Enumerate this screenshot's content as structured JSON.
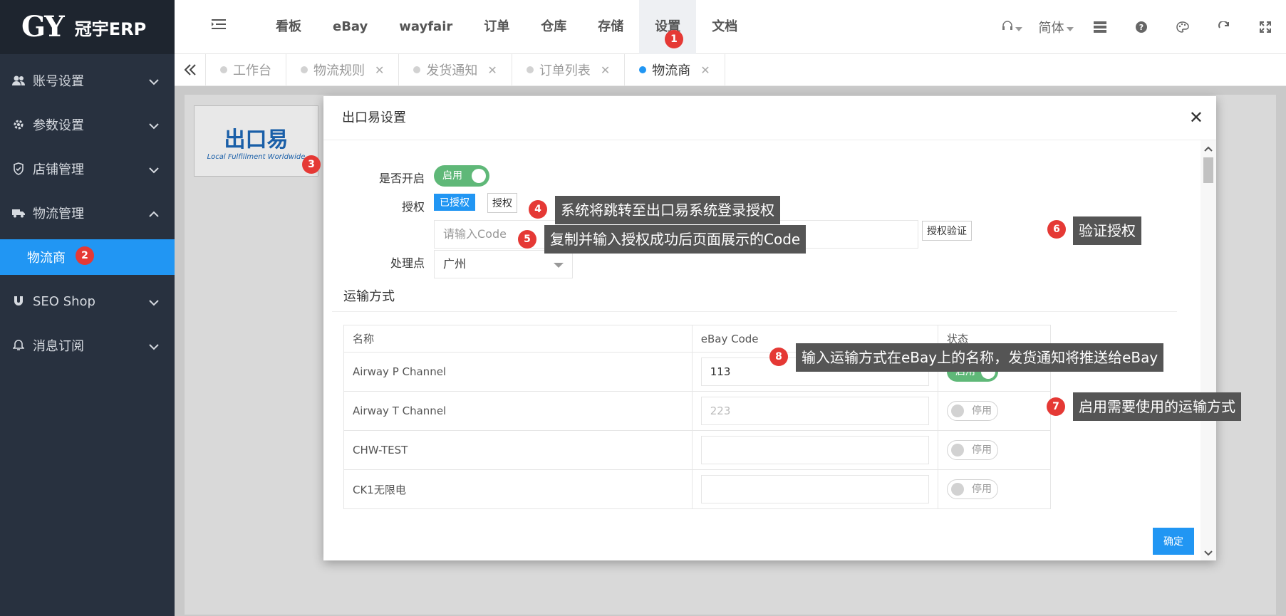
{
  "app": {
    "logo_mark": "GY",
    "brand": "冠宇ERP"
  },
  "sidebar": {
    "items": [
      {
        "label": "账号设置",
        "icon": "users-icon"
      },
      {
        "label": "参数设置",
        "icon": "gear-icon"
      },
      {
        "label": "店铺管理",
        "icon": "shield-icon"
      },
      {
        "label": "物流管理",
        "icon": "truck-icon",
        "expanded": true
      },
      {
        "label": "SEO Shop",
        "icon": "magnet-icon"
      },
      {
        "label": "消息订阅",
        "icon": "bell-icon"
      }
    ],
    "sub_item": {
      "label": "物流商"
    }
  },
  "header": {
    "nav": [
      "看板",
      "eBay",
      "wayfair",
      "订单",
      "仓库",
      "存储",
      "设置",
      "文档"
    ],
    "active": "设置",
    "language": "简体"
  },
  "tabs": [
    {
      "label": "工作台",
      "closable": false
    },
    {
      "label": "物流规则",
      "closable": true
    },
    {
      "label": "发货通知",
      "closable": true
    },
    {
      "label": "订单列表",
      "closable": true
    },
    {
      "label": "物流商",
      "closable": true,
      "active": true
    }
  ],
  "carrier": {
    "logo_text": "出口易",
    "logo_sub": "Local Fulfillment Worldwide"
  },
  "modal": {
    "title": "出口易设置",
    "enable_label": "是否开启",
    "enable_switch": "启用",
    "auth_label": "授权",
    "auth_status": "已授权",
    "auth_button": "授权",
    "code_placeholder": "请输入Code",
    "verify_button": "授权验证",
    "site_label": "处理点",
    "site_value": "广州",
    "section_title": "运输方式",
    "table": {
      "headers": [
        "名称",
        "eBay Code",
        "状态"
      ],
      "rows": [
        {
          "name": "Airway P Channel",
          "code": "113",
          "code_placeholder": "",
          "status": "启用",
          "on": true
        },
        {
          "name": "Airway T Channel",
          "code": "",
          "code_placeholder": "223",
          "status": "停用",
          "on": false
        },
        {
          "name": "CHW-TEST",
          "code": "",
          "code_placeholder": "",
          "status": "停用",
          "on": false
        },
        {
          "name": "CK1无限电",
          "code": "",
          "code_placeholder": "",
          "status": "停用",
          "on": false
        }
      ]
    },
    "ok_button": "确定"
  },
  "annotations": {
    "n1": "1",
    "n2": "2",
    "n3": "3",
    "n4": "4",
    "n5": "5",
    "n6": "6",
    "n7": "7",
    "n8": "8",
    "tip4": "系统将跳转至出口易系统登录授权",
    "tip5": "复制并输入授权成功后页面展示的Code",
    "tip6": "验证授权",
    "tip7": "启用需要使用的运输方式",
    "tip8": "输入运输方式在eBay上的名称，发货通知将推送给eBay"
  },
  "colors": {
    "sidebar": "#28313f",
    "accent": "#2196f3",
    "switch_on": "#5fb878",
    "annotation": "#e53935"
  }
}
